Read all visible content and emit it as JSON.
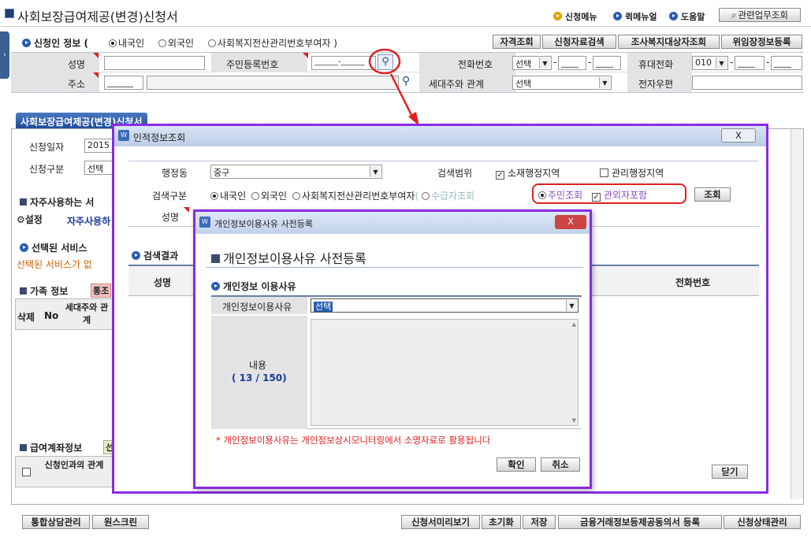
{
  "header": {
    "title": "사회보장급여제공(변경)신청서",
    "menu_new": "신청메뉴",
    "menu_quick": "퀵메뉴얼",
    "menu_help": "도움말",
    "related": "관련업무조회"
  },
  "applicant": {
    "section": "신청인 정보 (",
    "opt_domestic": "내국인",
    "opt_foreign": "외국인",
    "opt_welfare": "사회복지전산관리번호부여자 )",
    "btn_eligibility": "자격조회",
    "btn_search": "신청자료검색",
    "btn_survey": "조사복지대상자조회",
    "btn_delegate": "위임장정보등록",
    "name_label": "성명",
    "rrn_label": "주민등록번호",
    "rrn_value": "______-______",
    "phone_label": "전화번호",
    "phone_select": "선택",
    "mobile_label": "휴대전화",
    "mobile_prefix": "010",
    "addr_label": "주소",
    "addr_zip": "______",
    "rel_label": "세대주와 관계",
    "rel_select": "선택",
    "email_label": "전자우편"
  },
  "bg": {
    "tab": "사회보장급여제공(변경)신청서",
    "apply_date_label": "신청일자",
    "apply_date_value": "2015",
    "apply_type_label": "신청구분",
    "apply_type_value": "선택",
    "freq_section": "자주사용하는 서",
    "settings": "설정",
    "freq_link": "자주사용하",
    "selected_service": "선택된 서비스",
    "selected_note": "선택된 서비스가 없",
    "family": "가족 정보",
    "family_btn": "통조",
    "col_delete": "삭제",
    "col_no": "No",
    "col_relation": "세대주와 관계",
    "account": "급여계좌정보",
    "account_btn": "선",
    "col_applicant_rel": "신청인과의 관계"
  },
  "person_dialog": {
    "title": "인적정보조회",
    "close": "X",
    "dong_label": "행정동",
    "dong_value": "중구",
    "scope_label": "검색범위",
    "scope_admin": "소재행정지역",
    "scope_mgmt": "관리행정지역",
    "type_label": "검색구분",
    "type_domestic": "내국인",
    "type_foreign": "외국인",
    "type_welfare": "사회복지전산관리번호부여자",
    "type_recipient": "수급자조회",
    "type_rrn": "주민조회",
    "type_include": "관외자포함",
    "search_btn": "조회",
    "name_label": "성명",
    "result_label": "검색결과",
    "col_name": "성명",
    "col_phone": "전화번호",
    "close_btn": "닫기"
  },
  "reason_dialog": {
    "title": "개인정보이용사유 사전등록",
    "heading": "개인정보이용사유 사전등록",
    "section": "개인정보 이용사유",
    "reason_label": "개인정보이용사유",
    "reason_value": "선택",
    "content_label": "내용",
    "count": "( 13 / 150)",
    "note": "* 개인정보이용사유는 개인정보상시모니터링에서 소명자료로 활용됩니다",
    "ok": "확인",
    "cancel": "취소"
  },
  "footer": {
    "btn_consult": "통합상담관리",
    "btn_onescreen": "원스크린",
    "btn_preview": "신청서미리보기",
    "btn_reset": "초기화",
    "btn_save": "저장",
    "btn_finance": "금융거래정보등제공동의서 등록",
    "btn_status": "신청상태관리"
  },
  "colors": {
    "accent": "#8a2be2",
    "highlight": "#e02020",
    "title_blue": "#1f3f7a"
  }
}
